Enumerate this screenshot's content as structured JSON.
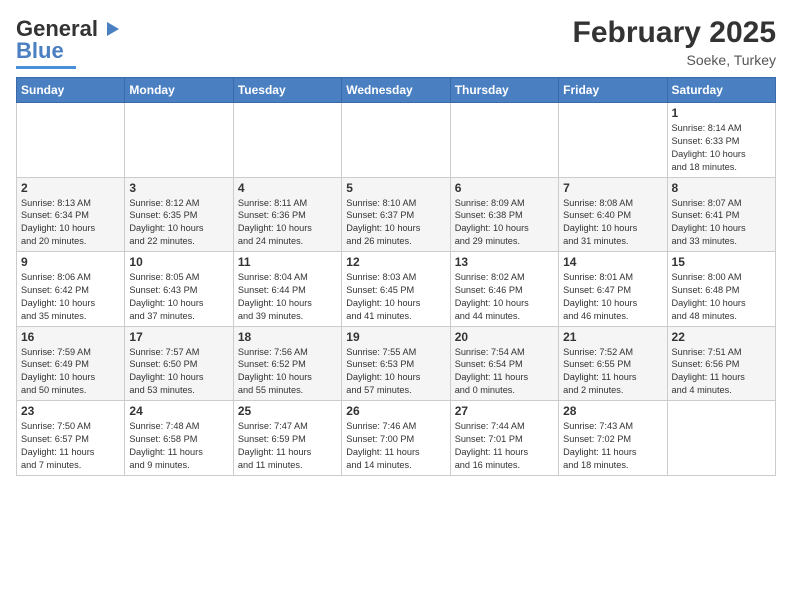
{
  "header": {
    "logo_general": "General",
    "logo_blue": "Blue",
    "month_title": "February 2025",
    "location": "Soeke, Turkey"
  },
  "days_of_week": [
    "Sunday",
    "Monday",
    "Tuesday",
    "Wednesday",
    "Thursday",
    "Friday",
    "Saturday"
  ],
  "weeks": [
    [
      {
        "day": "",
        "info": ""
      },
      {
        "day": "",
        "info": ""
      },
      {
        "day": "",
        "info": ""
      },
      {
        "day": "",
        "info": ""
      },
      {
        "day": "",
        "info": ""
      },
      {
        "day": "",
        "info": ""
      },
      {
        "day": "1",
        "info": "Sunrise: 8:14 AM\nSunset: 6:33 PM\nDaylight: 10 hours\nand 18 minutes."
      }
    ],
    [
      {
        "day": "2",
        "info": "Sunrise: 8:13 AM\nSunset: 6:34 PM\nDaylight: 10 hours\nand 20 minutes."
      },
      {
        "day": "3",
        "info": "Sunrise: 8:12 AM\nSunset: 6:35 PM\nDaylight: 10 hours\nand 22 minutes."
      },
      {
        "day": "4",
        "info": "Sunrise: 8:11 AM\nSunset: 6:36 PM\nDaylight: 10 hours\nand 24 minutes."
      },
      {
        "day": "5",
        "info": "Sunrise: 8:10 AM\nSunset: 6:37 PM\nDaylight: 10 hours\nand 26 minutes."
      },
      {
        "day": "6",
        "info": "Sunrise: 8:09 AM\nSunset: 6:38 PM\nDaylight: 10 hours\nand 29 minutes."
      },
      {
        "day": "7",
        "info": "Sunrise: 8:08 AM\nSunset: 6:40 PM\nDaylight: 10 hours\nand 31 minutes."
      },
      {
        "day": "8",
        "info": "Sunrise: 8:07 AM\nSunset: 6:41 PM\nDaylight: 10 hours\nand 33 minutes."
      }
    ],
    [
      {
        "day": "9",
        "info": "Sunrise: 8:06 AM\nSunset: 6:42 PM\nDaylight: 10 hours\nand 35 minutes."
      },
      {
        "day": "10",
        "info": "Sunrise: 8:05 AM\nSunset: 6:43 PM\nDaylight: 10 hours\nand 37 minutes."
      },
      {
        "day": "11",
        "info": "Sunrise: 8:04 AM\nSunset: 6:44 PM\nDaylight: 10 hours\nand 39 minutes."
      },
      {
        "day": "12",
        "info": "Sunrise: 8:03 AM\nSunset: 6:45 PM\nDaylight: 10 hours\nand 41 minutes."
      },
      {
        "day": "13",
        "info": "Sunrise: 8:02 AM\nSunset: 6:46 PM\nDaylight: 10 hours\nand 44 minutes."
      },
      {
        "day": "14",
        "info": "Sunrise: 8:01 AM\nSunset: 6:47 PM\nDaylight: 10 hours\nand 46 minutes."
      },
      {
        "day": "15",
        "info": "Sunrise: 8:00 AM\nSunset: 6:48 PM\nDaylight: 10 hours\nand 48 minutes."
      }
    ],
    [
      {
        "day": "16",
        "info": "Sunrise: 7:59 AM\nSunset: 6:49 PM\nDaylight: 10 hours\nand 50 minutes."
      },
      {
        "day": "17",
        "info": "Sunrise: 7:57 AM\nSunset: 6:50 PM\nDaylight: 10 hours\nand 53 minutes."
      },
      {
        "day": "18",
        "info": "Sunrise: 7:56 AM\nSunset: 6:52 PM\nDaylight: 10 hours\nand 55 minutes."
      },
      {
        "day": "19",
        "info": "Sunrise: 7:55 AM\nSunset: 6:53 PM\nDaylight: 10 hours\nand 57 minutes."
      },
      {
        "day": "20",
        "info": "Sunrise: 7:54 AM\nSunset: 6:54 PM\nDaylight: 11 hours\nand 0 minutes."
      },
      {
        "day": "21",
        "info": "Sunrise: 7:52 AM\nSunset: 6:55 PM\nDaylight: 11 hours\nand 2 minutes."
      },
      {
        "day": "22",
        "info": "Sunrise: 7:51 AM\nSunset: 6:56 PM\nDaylight: 11 hours\nand 4 minutes."
      }
    ],
    [
      {
        "day": "23",
        "info": "Sunrise: 7:50 AM\nSunset: 6:57 PM\nDaylight: 11 hours\nand 7 minutes."
      },
      {
        "day": "24",
        "info": "Sunrise: 7:48 AM\nSunset: 6:58 PM\nDaylight: 11 hours\nand 9 minutes."
      },
      {
        "day": "25",
        "info": "Sunrise: 7:47 AM\nSunset: 6:59 PM\nDaylight: 11 hours\nand 11 minutes."
      },
      {
        "day": "26",
        "info": "Sunrise: 7:46 AM\nSunset: 7:00 PM\nDaylight: 11 hours\nand 14 minutes."
      },
      {
        "day": "27",
        "info": "Sunrise: 7:44 AM\nSunset: 7:01 PM\nDaylight: 11 hours\nand 16 minutes."
      },
      {
        "day": "28",
        "info": "Sunrise: 7:43 AM\nSunset: 7:02 PM\nDaylight: 11 hours\nand 18 minutes."
      },
      {
        "day": "",
        "info": ""
      }
    ]
  ]
}
